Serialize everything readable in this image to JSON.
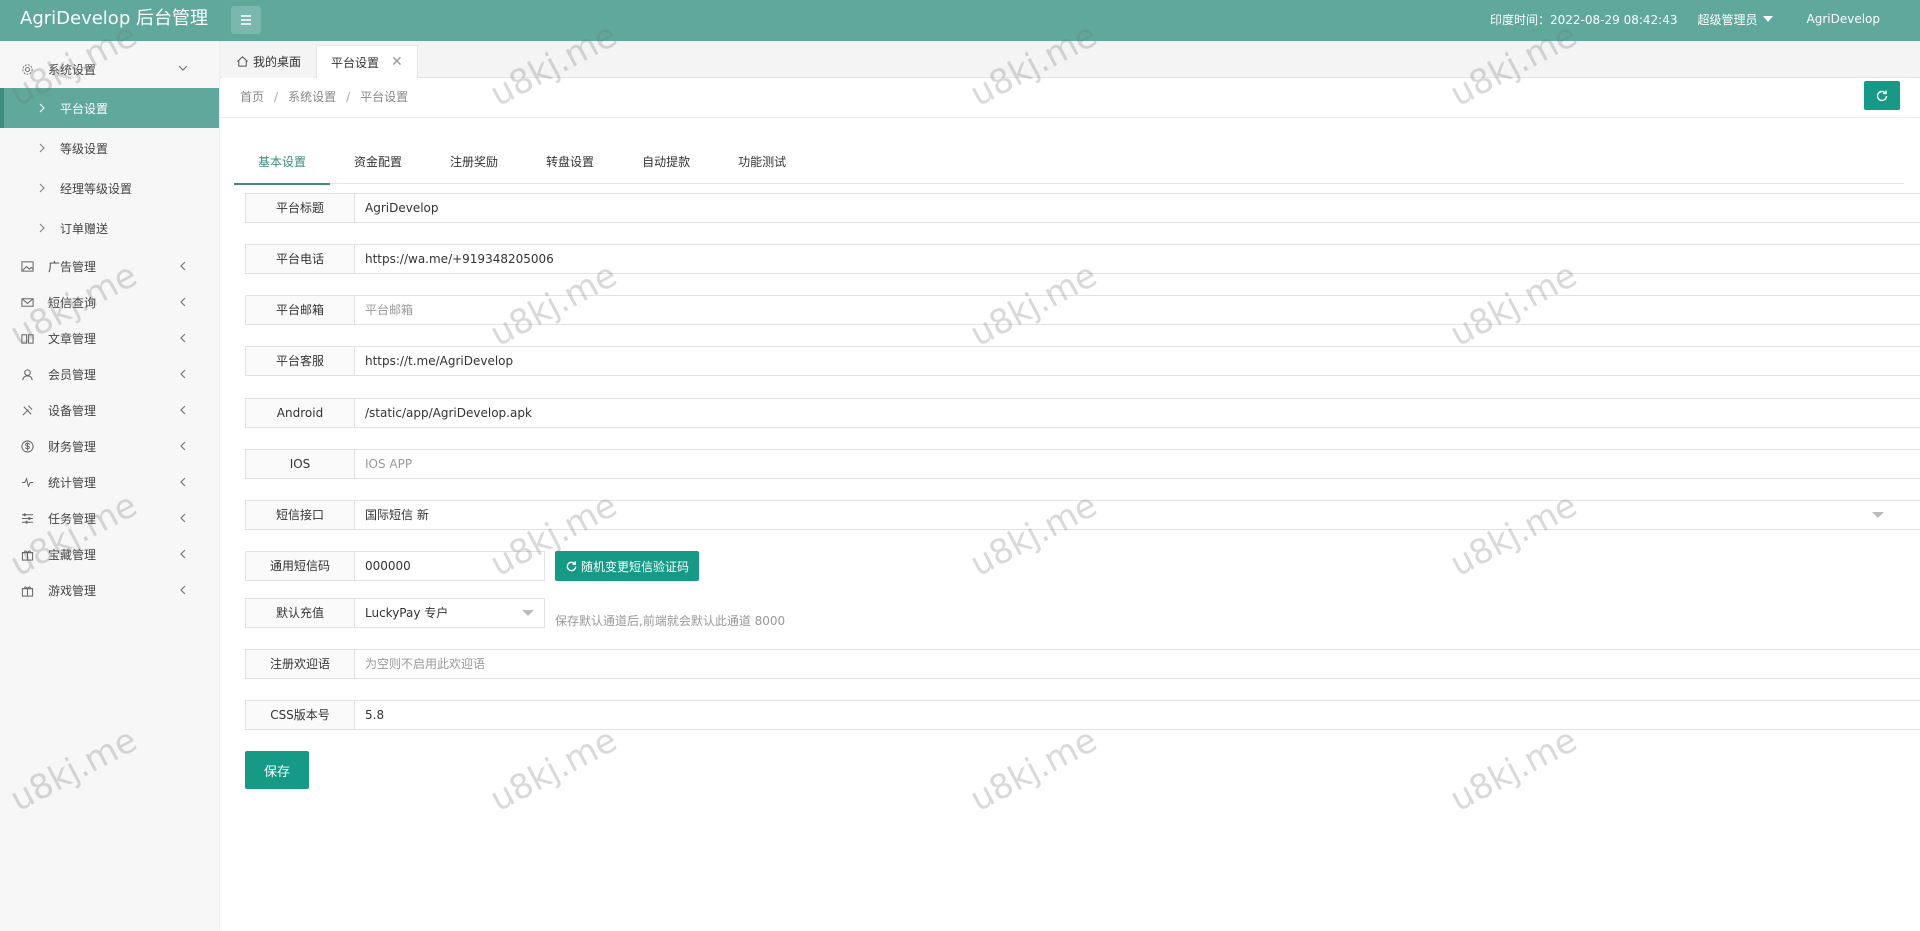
{
  "header": {
    "app_title": "AgriDevelop 后台管理",
    "time_label": "印度时间：2022-08-29 08:42:43",
    "role": "超级管理员",
    "user": "AgriDevelop"
  },
  "sidebar": {
    "groups": [
      {
        "label": "系统设置",
        "icon": "gear-icon",
        "expanded": true,
        "items": [
          {
            "label": "平台设置",
            "active": true
          },
          {
            "label": "等级设置"
          },
          {
            "label": "经理等级设置"
          },
          {
            "label": "订单赠送"
          }
        ]
      },
      {
        "label": "广告管理",
        "icon": "image-icon"
      },
      {
        "label": "短信查询",
        "icon": "mail-icon"
      },
      {
        "label": "文章管理",
        "icon": "book-icon"
      },
      {
        "label": "会员管理",
        "icon": "user-icon"
      },
      {
        "label": "设备管理",
        "icon": "tools-icon"
      },
      {
        "label": "财务管理",
        "icon": "dollar-icon"
      },
      {
        "label": "统计管理",
        "icon": "pulse-icon"
      },
      {
        "label": "任务管理",
        "icon": "sliders-icon"
      },
      {
        "label": "宝藏管理",
        "icon": "gift-icon"
      },
      {
        "label": "游戏管理",
        "icon": "gift-icon"
      }
    ]
  },
  "tabs": {
    "home": "我的桌面",
    "current": "平台设置"
  },
  "breadcrumb": [
    "首页",
    "系统设置",
    "平台设置"
  ],
  "content_tabs": [
    "基本设置",
    "资金配置",
    "注册奖励",
    "转盘设置",
    "自动提款",
    "功能测试"
  ],
  "form": {
    "platform_title": {
      "label": "平台标题",
      "value": "AgriDevelop"
    },
    "platform_phone": {
      "label": "平台电话",
      "value": "https://wa.me/+919348205006"
    },
    "platform_email": {
      "label": "平台邮箱",
      "placeholder": "平台邮箱"
    },
    "platform_support": {
      "label": "平台客服",
      "value": "https://t.me/AgriDevelop"
    },
    "android": {
      "label": "Android",
      "value": "/static/app/AgriDevelop.apk"
    },
    "ios": {
      "label": "IOS",
      "placeholder": "IOS APP"
    },
    "sms_api": {
      "label": "短信接口",
      "value": "国际短信 新"
    },
    "sms_code": {
      "label": "通用短信码",
      "value": "000000",
      "button": "随机变更短信验证码"
    },
    "default_recharge": {
      "label": "默认充值",
      "value": "LuckyPay 专户",
      "hint": "保存默认通道后,前端就会默认此通道 8000"
    },
    "welcome": {
      "label": "注册欢迎语",
      "placeholder": "为空则不启用此欢迎语"
    },
    "css_version": {
      "label": "CSS版本号",
      "value": "5.8"
    },
    "save": "保存"
  },
  "watermark": "u8kj.me",
  "colors": {
    "header": "#5fa89b",
    "accent": "#159a86",
    "active_tab": "#3e8c7e"
  }
}
